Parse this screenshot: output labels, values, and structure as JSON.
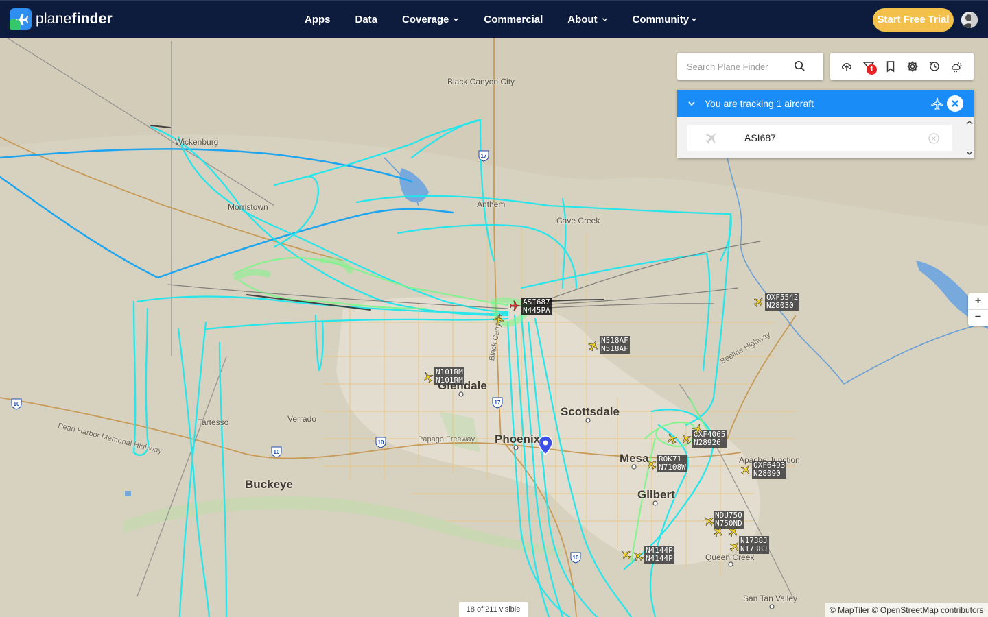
{
  "header": {
    "brand_light": "plane",
    "brand_bold": "finder",
    "nav": [
      {
        "label": "Apps",
        "has_dropdown": false
      },
      {
        "label": "Data",
        "has_dropdown": false
      },
      {
        "label": "Coverage",
        "has_dropdown": true
      },
      {
        "label": "Commercial",
        "has_dropdown": false
      },
      {
        "label": "About",
        "has_dropdown": true
      },
      {
        "label": "Community",
        "has_dropdown": true
      }
    ],
    "cta_label": "Start Free Trial",
    "colors": {
      "bar": "#0d1c3d",
      "cta": "#f2c04b"
    }
  },
  "search": {
    "placeholder": "Search Plane Finder",
    "value": ""
  },
  "toolbar": {
    "icons": [
      "upload-cloud-icon",
      "filter-icon",
      "bookmark-icon",
      "settings-gear-icon",
      "history-clock-icon",
      "weather-icon"
    ],
    "filter_badge": "1"
  },
  "tracking": {
    "title": "You are tracking 1 aircraft",
    "items": [
      {
        "callsign": "ASI687"
      }
    ],
    "color": "#1a8cf7"
  },
  "map": {
    "places": [
      {
        "name": "Black Canyon City",
        "size": "small"
      },
      {
        "name": "Wickenburg",
        "size": "small"
      },
      {
        "name": "Morristown",
        "size": "small"
      },
      {
        "name": "Anthem",
        "size": "small"
      },
      {
        "name": "Cave Creek",
        "size": "small"
      },
      {
        "name": "Glendale",
        "size": "big"
      },
      {
        "name": "Scottsdale",
        "size": "big"
      },
      {
        "name": "Phoenix",
        "size": "big"
      },
      {
        "name": "Mesa",
        "size": "big"
      },
      {
        "name": "Gilbert",
        "size": "big"
      },
      {
        "name": "Buckeye",
        "size": "big"
      },
      {
        "name": "Tartesso",
        "size": "small"
      },
      {
        "name": "Verrado",
        "size": "small"
      },
      {
        "name": "Apache Junction",
        "size": "small"
      },
      {
        "name": "Queen Creek",
        "size": "small"
      },
      {
        "name": "San Tan Valley",
        "size": "small"
      },
      {
        "name": "Pearl Harbor Memorial Highway",
        "size": "road"
      },
      {
        "name": "Papago Freeway",
        "size": "road"
      },
      {
        "name": "Beeline Highway",
        "size": "road"
      },
      {
        "name": "Black Canyon",
        "size": "road"
      }
    ],
    "highway_shields": [
      "17",
      "17",
      "10",
      "10",
      "10",
      "10"
    ],
    "aircraft": [
      {
        "callsign": "ASI687",
        "reg": "N445PA",
        "tracked": true
      },
      {
        "callsign": "OXF5542",
        "reg": "N28030",
        "tracked": false
      },
      {
        "callsign": "N518AF",
        "reg": "N518AF",
        "tracked": false
      },
      {
        "callsign": "N101RM",
        "reg": "N101RM",
        "tracked": false
      },
      {
        "callsign": "OXF4065",
        "reg": "N28926",
        "tracked": false
      },
      {
        "callsign": "ROK71",
        "reg": "N7108W",
        "tracked": false
      },
      {
        "callsign": "OXF6493",
        "reg": "N28090",
        "tracked": false
      },
      {
        "callsign": "NDU750",
        "reg": "N750ND",
        "tracked": false
      },
      {
        "callsign": "N1738J",
        "reg": "N1738J",
        "tracked": false
      },
      {
        "callsign": "N4144P",
        "reg": "N4144P",
        "tracked": false
      }
    ],
    "track_colors": {
      "primary": "#1fe6ee",
      "secondary": "#7df58a",
      "outbound": "#1ea5f0"
    }
  },
  "zoom": {
    "in": "+",
    "out": "−"
  },
  "status": {
    "visible": "18 of 211 visible"
  },
  "attribution": "© MapTiler © OpenStreetMap contributors"
}
